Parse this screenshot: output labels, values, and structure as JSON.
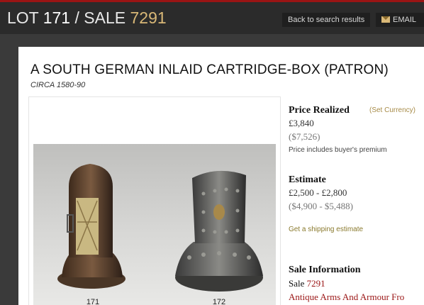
{
  "header": {
    "lot_label": "LOT",
    "lot_number": "171",
    "separator": "/",
    "sale_label": "SALE",
    "sale_number": "7291",
    "back_button": "Back to search results",
    "email_button": "EMAIL",
    "email_icon": "envelope-icon"
  },
  "item": {
    "title": "A SOUTH GERMAN INLAID CARTRIDGE-BOX (PATRON)",
    "circa": "CIRCA 1580-90",
    "image_labels": [
      "171",
      "172"
    ]
  },
  "price_realized": {
    "heading": "Price Realized",
    "set_currency": "(Set Currency)",
    "primary": "£3,840",
    "converted": "($7,526)",
    "note": "Price includes buyer's premium"
  },
  "estimate": {
    "heading": "Estimate",
    "primary": "£2,500 - £2,800",
    "converted": "($4,900 - $5,488)",
    "shipping_link": "Get a shipping estimate"
  },
  "sale_information": {
    "heading": "Sale Information",
    "sale_prefix": "Sale",
    "sale_number": "7291",
    "sale_name": "Antique Arms And Armour Fro"
  }
}
